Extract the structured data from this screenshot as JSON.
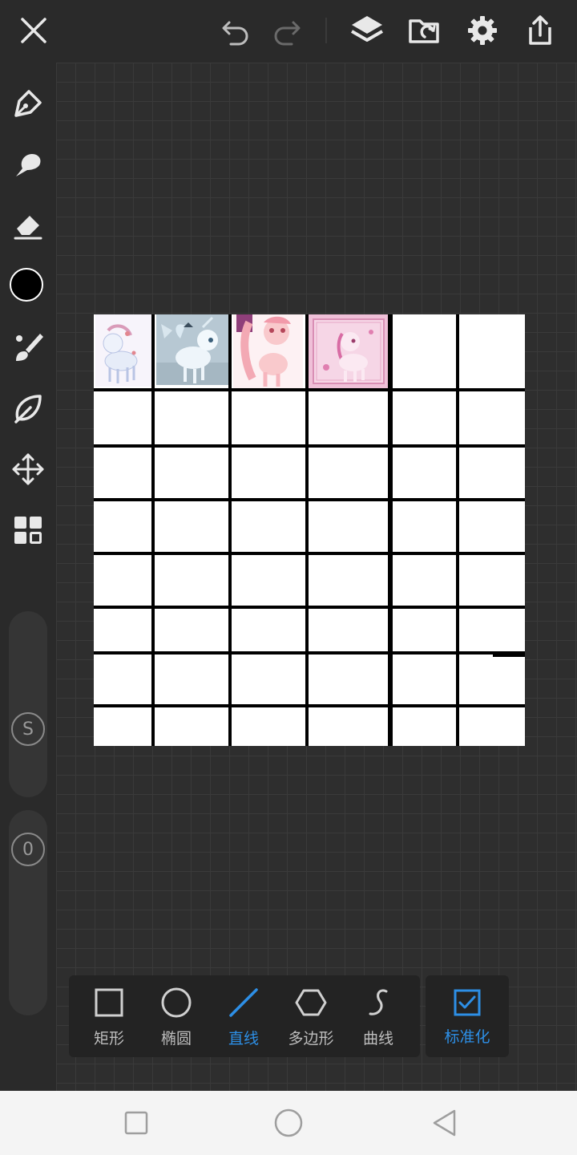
{
  "topbar": {
    "icons": [
      "close-icon",
      "undo-icon",
      "redo-icon",
      "layers-icon",
      "import-file-icon",
      "gear-icon",
      "share-icon"
    ]
  },
  "tools": [
    "pen-icon",
    "smudge-icon",
    "eraser-icon",
    "color-picker",
    "brush-icon",
    "leaf-icon",
    "move-icon",
    "grid-layout-icon"
  ],
  "current_color": "#000000",
  "sliders": {
    "size_label": "S",
    "opacity_label": "0"
  },
  "shapes": {
    "rect": "矩形",
    "ellipse": "椭圆",
    "line": "直线",
    "polygon": "多边形",
    "curve": "曲线",
    "active": "直线"
  },
  "normalize": {
    "label": "标准化",
    "checked": true
  },
  "colors": {
    "accent": "#2d8fe6",
    "toolbar_bg": "#2a2a2a",
    "panel_bg": "#232323",
    "icon": "#e8e8e8"
  }
}
